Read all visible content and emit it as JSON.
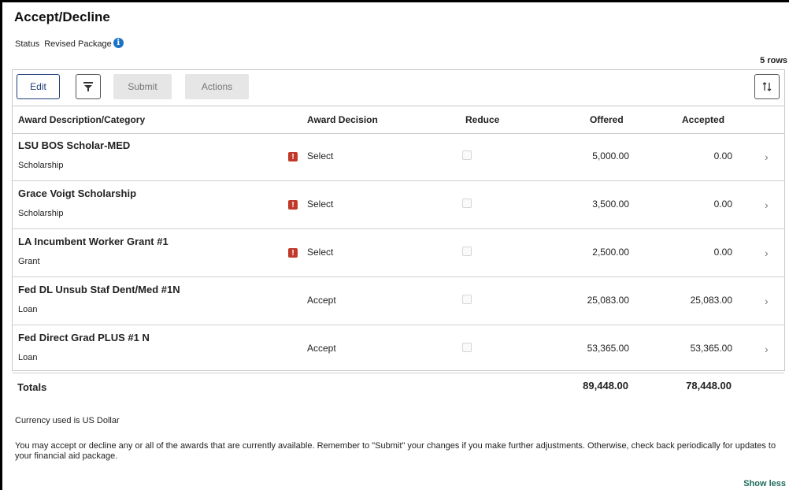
{
  "page": {
    "title": "Accept/Decline",
    "status_label": "Status",
    "status_value": "Revised Package",
    "info_icon": "i",
    "rows_count": "5 rows"
  },
  "toolbar": {
    "edit_label": "Edit",
    "filter_icon": "filter-icon",
    "submit_label": "Submit",
    "actions_label": "Actions",
    "sort_icon": "sort-icon"
  },
  "columns": {
    "description": "Award Description/Category",
    "decision": "Award Decision",
    "reduce": "Reduce",
    "offered": "Offered",
    "accepted": "Accepted"
  },
  "rows": [
    {
      "title": "LSU BOS Scholar-MED",
      "category": "Scholarship",
      "warning": true,
      "decision": "Select",
      "offered": "5,000.00",
      "accepted": "0.00"
    },
    {
      "title": "Grace Voigt Scholarship",
      "category": "Scholarship",
      "warning": true,
      "decision": "Select",
      "offered": "3,500.00",
      "accepted": "0.00"
    },
    {
      "title": "LA Incumbent Worker Grant #1",
      "category": "Grant",
      "warning": true,
      "decision": "Select",
      "offered": "2,500.00",
      "accepted": "0.00"
    },
    {
      "title": "Fed DL Unsub Staf Dent/Med #1N",
      "category": "Loan",
      "warning": false,
      "decision": "Accept",
      "offered": "25,083.00",
      "accepted": "25,083.00"
    },
    {
      "title": "Fed Direct Grad PLUS #1 N",
      "category": "Loan",
      "warning": false,
      "decision": "Accept",
      "offered": "53,365.00",
      "accepted": "53,365.00"
    }
  ],
  "totals": {
    "label": "Totals",
    "offered": "89,448.00",
    "accepted": "78,448.00"
  },
  "footer": {
    "currency_note": "Currency used is US Dollar",
    "instruction": "You may accept or decline any or all of the awards that are currently available. Remember to \"Submit\" your changes if you make further adjustments. Otherwise, check back periodically for updates to your financial aid package.",
    "show_less": "Show less"
  },
  "colors": {
    "accent": "#1f3d7a",
    "warning": "#c0392b",
    "link": "#1f6b5a",
    "info": "#1a73c7"
  }
}
